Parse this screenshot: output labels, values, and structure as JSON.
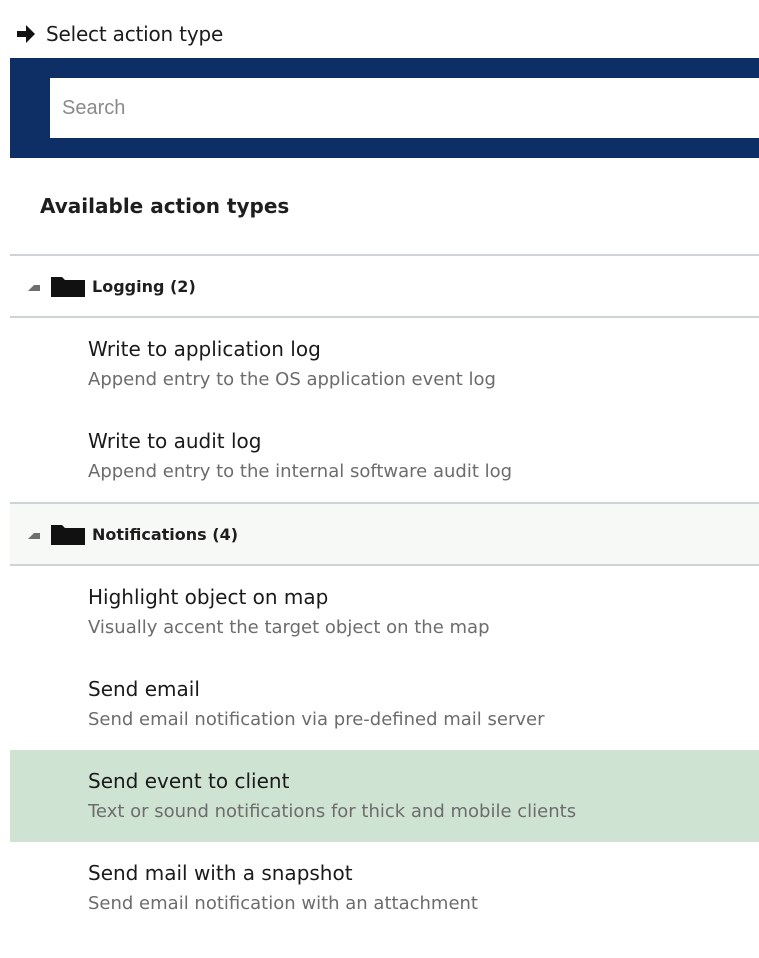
{
  "header": {
    "title": "Select action type",
    "icon": "arrow-right-icon"
  },
  "search": {
    "placeholder": "Search",
    "value": ""
  },
  "section": {
    "title": "Available action types"
  },
  "groups": [
    {
      "label": "Logging (2)",
      "icon": "folder-icon",
      "items": [
        {
          "title": "Write to application log",
          "desc": "Append entry to the OS application event log"
        },
        {
          "title": "Write to audit log",
          "desc": "Append entry to the internal software audit log"
        }
      ]
    },
    {
      "label": "Notifications (4)",
      "icon": "folder-icon",
      "items": [
        {
          "title": "Highlight object on map",
          "desc": "Visually accent the target object on the map"
        },
        {
          "title": "Send email",
          "desc": "Send email notification via pre-defined mail server"
        },
        {
          "title": "Send event to client",
          "desc": "Text or sound notifications for thick and mobile clients",
          "selected": true
        },
        {
          "title": "Send mail with a snapshot",
          "desc": "Send email notification with an attachment"
        }
      ]
    }
  ],
  "colors": {
    "header_band": "#0e2f66",
    "selected_row": "#cfe3d3",
    "divider": "#cfd3d6"
  }
}
